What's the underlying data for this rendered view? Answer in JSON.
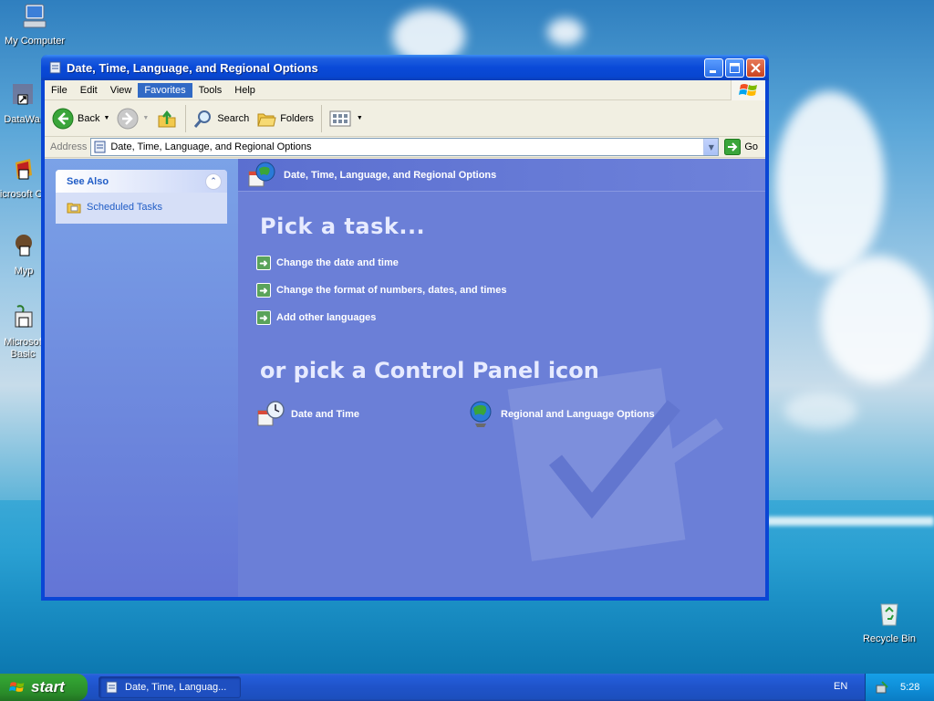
{
  "desktop": {
    "icons": [
      {
        "label": "My Computer"
      },
      {
        "label": "DataWa"
      },
      {
        "label": "Microsoft C++"
      },
      {
        "label": "Myp"
      },
      {
        "label": "Microsof Basic"
      }
    ],
    "recycle_bin": "Recycle Bin"
  },
  "window": {
    "title": "Date, Time, Language, and Regional Options",
    "menu": [
      "File",
      "Edit",
      "View",
      "Favorites",
      "Tools",
      "Help"
    ],
    "menu_active": "Favorites",
    "toolbar": {
      "back": "Back",
      "search": "Search",
      "folders": "Folders"
    },
    "address": {
      "label": "Address",
      "value": "Date, Time, Language, and Regional Options",
      "go": "Go"
    },
    "left_pane": {
      "see_also_title": "See Also",
      "links": [
        "Scheduled Tasks"
      ]
    },
    "main": {
      "header": "Date, Time, Language, and Regional Options",
      "pick_task_title": "Pick a task...",
      "tasks": [
        "Change the date and time",
        "Change the format of numbers, dates, and times",
        "Add other languages"
      ],
      "pick_icon_title": "or pick a Control Panel icon",
      "icons": [
        {
          "label": "Date and Time"
        },
        {
          "label": "Regional and Language Options"
        }
      ]
    }
  },
  "taskbar": {
    "start": "start",
    "task_item": "Date, Time, Languag...",
    "language": "EN",
    "clock": "5:28"
  }
}
